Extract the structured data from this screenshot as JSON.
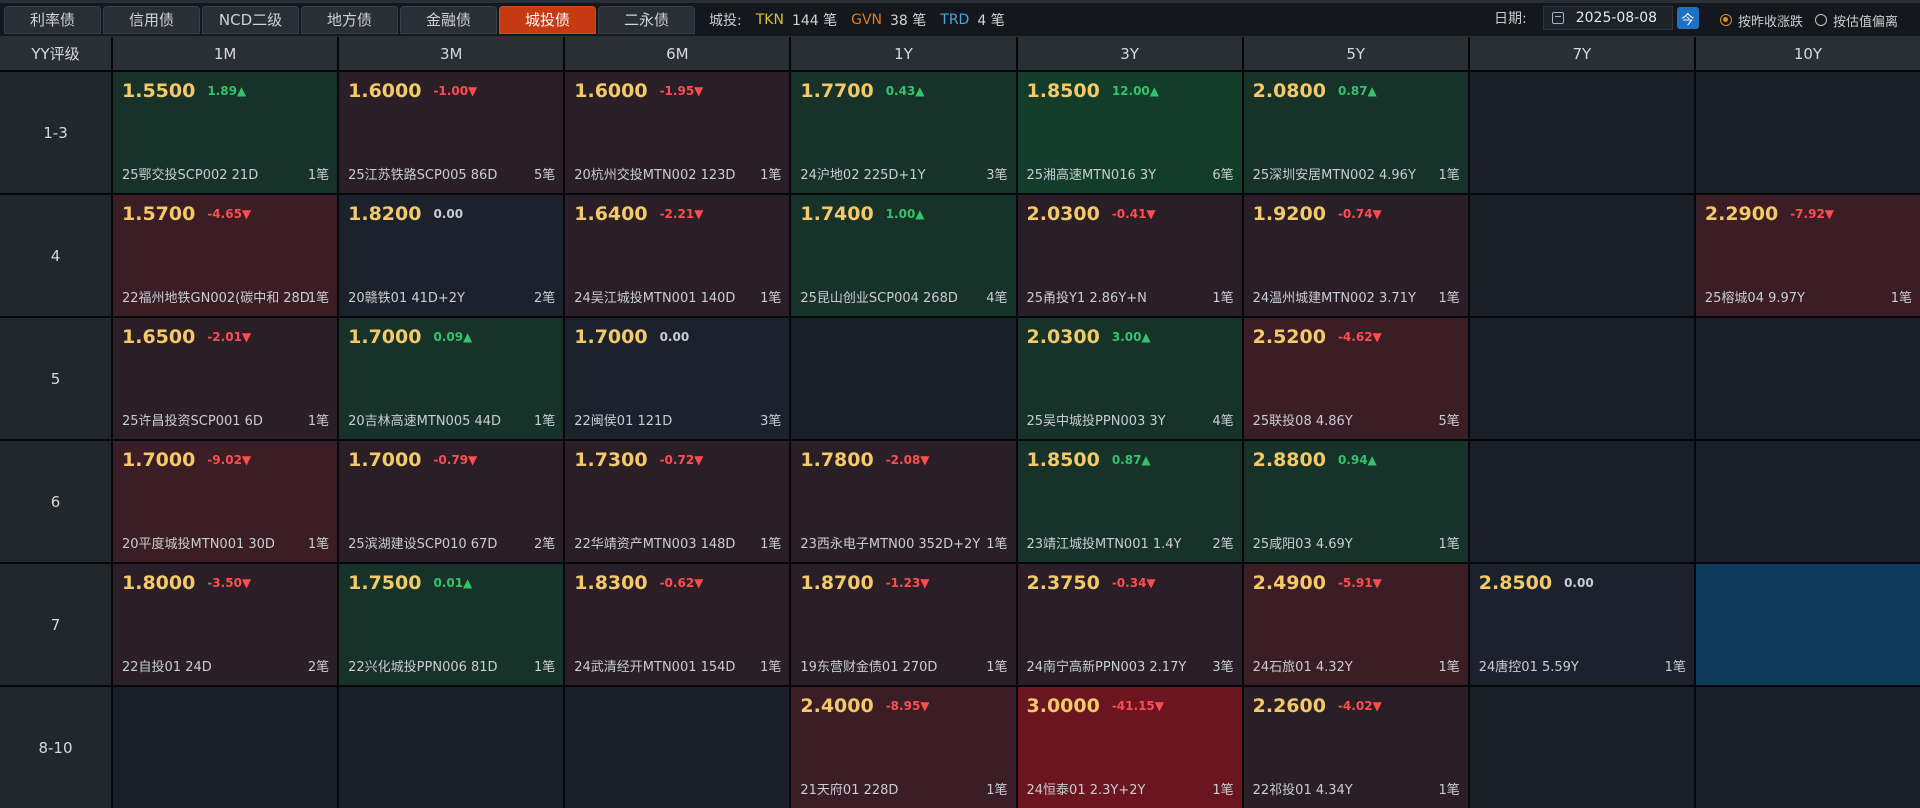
{
  "tabs": [
    {
      "label": "利率债",
      "active": false
    },
    {
      "label": "信用债",
      "active": false
    },
    {
      "label": "NCD二级",
      "active": false
    },
    {
      "label": "地方债",
      "active": false
    },
    {
      "label": "金融债",
      "active": false
    },
    {
      "label": "城投债",
      "active": true
    },
    {
      "label": "二永债",
      "active": false
    }
  ],
  "summary": {
    "label": "城投:",
    "tkn_code": "TKN",
    "tkn_count": "144 笔",
    "gvn_code": "GVN",
    "gvn_count": "38 笔",
    "trd_code": "TRD",
    "trd_count": "4 笔"
  },
  "date": {
    "label": "日期:",
    "value": "2025-08-08",
    "today_label": "今"
  },
  "radios": [
    {
      "label": "按昨收涨跌",
      "checked": true
    },
    {
      "label": "按估值偏离",
      "checked": false
    }
  ],
  "grid": {
    "corner": "YY评级",
    "columns": [
      "1M",
      "3M",
      "6M",
      "1Y",
      "3Y",
      "5Y",
      "7Y",
      "10Y"
    ],
    "rows": [
      {
        "rating": "1-3",
        "cells": [
          {
            "yield": "1.5500",
            "change": "1.89▲",
            "dir": "up",
            "bond": "25鄂交投SCP002 21D",
            "trades": "1笔",
            "tone": "up"
          },
          {
            "yield": "1.6000",
            "change": "-1.00▼",
            "dir": "down",
            "bond": "25江苏铁路SCP005 86D",
            "trades": "5笔",
            "tone": "down"
          },
          {
            "yield": "1.6000",
            "change": "-1.95▼",
            "dir": "down",
            "bond": "20杭州交投MTN002 123D",
            "trades": "1笔",
            "tone": "down"
          },
          {
            "yield": "1.7700",
            "change": "0.43▲",
            "dir": "up",
            "bond": "24沪地02 225D+1Y",
            "trades": "3笔",
            "tone": "up"
          },
          {
            "yield": "1.8500",
            "change": "12.00▲",
            "dir": "up",
            "bond": "25湘高速MTN016 3Y",
            "trades": "6笔",
            "tone": "upstrong"
          },
          {
            "yield": "2.0800",
            "change": "0.87▲",
            "dir": "up",
            "bond": "25深圳安居MTN002 4.96Y",
            "trades": "1笔",
            "tone": "up"
          },
          null,
          null
        ]
      },
      {
        "rating": "4",
        "cells": [
          {
            "yield": "1.5700",
            "change": "-4.65▼",
            "dir": "down",
            "bond": "22福州地铁GN002(碳中和",
            "bond_tail": "28D",
            "trades": "1笔",
            "tone": "downmid"
          },
          {
            "yield": "1.8200",
            "change": "0.00",
            "dir": "zero",
            "bond": "20赣铁01 41D+2Y",
            "trades": "2笔",
            "tone": "flat"
          },
          {
            "yield": "1.6400",
            "change": "-2.21▼",
            "dir": "down",
            "bond": "24吴江城投MTN001 140D",
            "trades": "1笔",
            "tone": "down"
          },
          {
            "yield": "1.7400",
            "change": "1.00▲",
            "dir": "up",
            "bond": "25昆山创业SCP004 268D",
            "trades": "4笔",
            "tone": "up"
          },
          {
            "yield": "2.0300",
            "change": "-0.41▼",
            "dir": "down",
            "bond": "25甬投Y1 2.86Y+N",
            "trades": "1笔",
            "tone": "down"
          },
          {
            "yield": "1.9200",
            "change": "-0.74▼",
            "dir": "down",
            "bond": "24温州城建MTN002 3.71Y",
            "trades": "1笔",
            "tone": "down"
          },
          null,
          {
            "yield": "2.2900",
            "change": "-7.92▼",
            "dir": "down",
            "bond": "25榕城04 9.97Y",
            "trades": "1笔",
            "tone": "downmid"
          }
        ]
      },
      {
        "rating": "5",
        "cells": [
          {
            "yield": "1.6500",
            "change": "-2.01▼",
            "dir": "down",
            "bond": "25许昌投资SCP001 6D",
            "trades": "1笔",
            "tone": "down"
          },
          {
            "yield": "1.7000",
            "change": "0.09▲",
            "dir": "up",
            "bond": "20吉林高速MTN005 44D",
            "trades": "1笔",
            "tone": "up"
          },
          {
            "yield": "1.7000",
            "change": "0.00",
            "dir": "zero",
            "bond": "22闽侯01 121D",
            "trades": "3笔",
            "tone": "flat"
          },
          null,
          {
            "yield": "2.0300",
            "change": "3.00▲",
            "dir": "up",
            "bond": "25吴中城投PPN003 3Y",
            "trades": "4笔",
            "tone": "up"
          },
          {
            "yield": "2.5200",
            "change": "-4.62▼",
            "dir": "down",
            "bond": "25联投08 4.86Y",
            "trades": "5笔",
            "tone": "downmid"
          },
          null,
          null
        ]
      },
      {
        "rating": "6",
        "cells": [
          {
            "yield": "1.7000",
            "change": "-9.02▼",
            "dir": "down",
            "bond": "20平度城投MTN001 30D",
            "trades": "1笔",
            "tone": "downmid"
          },
          {
            "yield": "1.7000",
            "change": "-0.79▼",
            "dir": "down",
            "bond": "25滨湖建设SCP010 67D",
            "trades": "2笔",
            "tone": "down"
          },
          {
            "yield": "1.7300",
            "change": "-0.72▼",
            "dir": "down",
            "bond": "22华靖资产MTN003 148D",
            "trades": "1笔",
            "tone": "down"
          },
          {
            "yield": "1.7800",
            "change": "-2.08▼",
            "dir": "down",
            "bond": "23西永电子MTN00",
            "bond_tail": "352D+2Y",
            "trades": "1笔",
            "tone": "down"
          },
          {
            "yield": "1.8500",
            "change": "0.87▲",
            "dir": "up",
            "bond": "23靖江城投MTN001 1.4Y",
            "trades": "2笔",
            "tone": "up"
          },
          {
            "yield": "2.8800",
            "change": "0.94▲",
            "dir": "up",
            "bond": "25咸阳03 4.69Y",
            "trades": "1笔",
            "tone": "up"
          },
          null,
          null
        ]
      },
      {
        "rating": "7",
        "cells": [
          {
            "yield": "1.8000",
            "change": "-3.50▼",
            "dir": "down",
            "bond": "22自投01 24D",
            "trades": "2笔",
            "tone": "down"
          },
          {
            "yield": "1.7500",
            "change": "0.01▲",
            "dir": "up",
            "bond": "22兴化城投PPN006 81D",
            "trades": "1笔",
            "tone": "up"
          },
          {
            "yield": "1.8300",
            "change": "-0.62▼",
            "dir": "down",
            "bond": "24武清经开MTN001 154D",
            "trades": "1笔",
            "tone": "down"
          },
          {
            "yield": "1.8700",
            "change": "-1.23▼",
            "dir": "down",
            "bond": "19东营财金债01 270D",
            "trades": "1笔",
            "tone": "down"
          },
          {
            "yield": "2.3750",
            "change": "-0.34▼",
            "dir": "down",
            "bond": "24南宁高新PPN003 2.17Y",
            "trades": "3笔",
            "tone": "down"
          },
          {
            "yield": "2.4900",
            "change": "-5.91▼",
            "dir": "down",
            "bond": "24石旅01 4.32Y",
            "trades": "1笔",
            "tone": "downmid"
          },
          {
            "yield": "2.8500",
            "change": "0.00",
            "dir": "zero",
            "bond": "24唐控01 5.59Y",
            "trades": "1笔",
            "tone": "flat"
          },
          {
            "selected": true
          }
        ]
      },
      {
        "rating": "8-10",
        "cells": [
          null,
          null,
          null,
          {
            "yield": "2.4000",
            "change": "-8.95▼",
            "dir": "down",
            "bond": "21天府01 228D",
            "trades": "1笔",
            "tone": "downmid"
          },
          {
            "yield": "3.0000",
            "change": "-41.15▼",
            "dir": "down",
            "bond": "24恒泰01 2.3Y+2Y",
            "trades": "1笔",
            "tone": "downstrong"
          },
          {
            "yield": "2.2600",
            "change": "-4.02▼",
            "dir": "down",
            "bond": "22祁投01 4.34Y",
            "trades": "1笔",
            "tone": "down"
          },
          null,
          null
        ]
      }
    ]
  }
}
